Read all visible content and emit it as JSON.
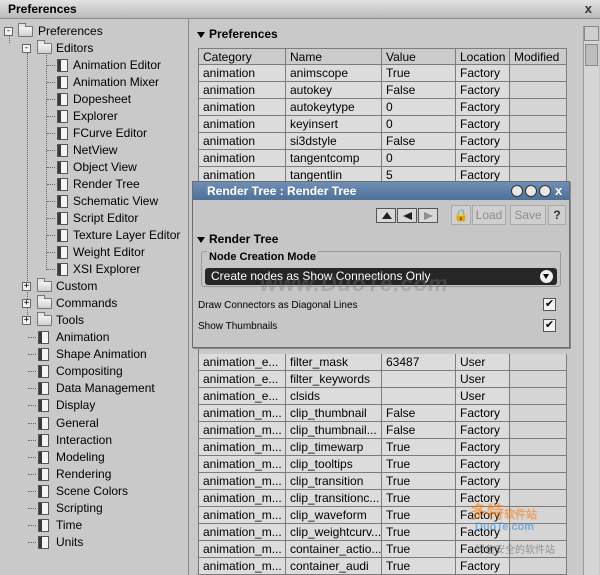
{
  "window": {
    "title": "Preferences",
    "close_glyph": "x"
  },
  "tree": {
    "root": "Preferences",
    "editors": {
      "label": "Editors",
      "items": [
        "Animation Editor",
        "Animation Mixer",
        "Dopesheet",
        "Explorer",
        "FCurve Editor",
        "NetView",
        "Object View",
        "Render Tree",
        "Schematic View",
        "Script Editor",
        "Texture Layer Editor",
        "Weight Editor",
        "XSI Explorer"
      ]
    },
    "folders": [
      "Custom",
      "Commands",
      "Tools"
    ],
    "pages": [
      "Animation",
      "Shape Animation",
      "Compositing",
      "Data Management",
      "Display",
      "General",
      "Interaction",
      "Modeling",
      "Rendering",
      "Scene Colors",
      "Scripting",
      "Time",
      "Units"
    ]
  },
  "prefs": {
    "section_title": "Preferences",
    "columns": [
      "Category",
      "Name",
      "Value",
      "Location",
      "Modified"
    ],
    "rows_top": [
      [
        "animation",
        "animscope",
        "True",
        "Factory",
        ""
      ],
      [
        "animation",
        "autokey",
        "False",
        "Factory",
        ""
      ],
      [
        "animation",
        "autokeytype",
        "0",
        "Factory",
        ""
      ],
      [
        "animation",
        "keyinsert",
        "0",
        "Factory",
        ""
      ],
      [
        "animation",
        "si3dstyle",
        "False",
        "Factory",
        ""
      ],
      [
        "animation",
        "tangentcomp",
        "0",
        "Factory",
        ""
      ],
      [
        "animation",
        "tangentlin",
        "5",
        "Factory",
        ""
      ]
    ],
    "rows_bottom": [
      [
        "animation_e...",
        "filter_mask",
        "63487",
        "User",
        ""
      ],
      [
        "animation_e...",
        "filter_keywords",
        "",
        "User",
        ""
      ],
      [
        "animation_e...",
        "clsids",
        "",
        "User",
        ""
      ],
      [
        "animation_m...",
        "clip_thumbnail",
        "False",
        "Factory",
        ""
      ],
      [
        "animation_m...",
        "clip_thumbnail...",
        "False",
        "Factory",
        ""
      ],
      [
        "animation_m...",
        "clip_timewarp",
        "True",
        "Factory",
        ""
      ],
      [
        "animation_m...",
        "clip_tooltips",
        "True",
        "Factory",
        ""
      ],
      [
        "animation_m...",
        "clip_transition",
        "True",
        "Factory",
        ""
      ],
      [
        "animation_m...",
        "clip_transitionc...",
        "True",
        "Factory",
        ""
      ],
      [
        "animation_m...",
        "clip_waveform",
        "True",
        "Factory",
        ""
      ],
      [
        "animation_m...",
        "clip_weightcurv...",
        "True",
        "Factory",
        ""
      ],
      [
        "animation_m...",
        "container_actio...",
        "True",
        "Factory",
        ""
      ],
      [
        "animation_m...",
        "container_audi",
        "True",
        "Factory",
        ""
      ]
    ]
  },
  "render_tree": {
    "title": "Render Tree : Render Tree",
    "load_label": "Load",
    "save_label": "Save",
    "help_label": "?",
    "section_title": "Render Tree",
    "node_creation_mode_label": "Node Creation Mode",
    "node_creation_mode_value": "Create nodes as Show Connections Only",
    "draw_connectors_label": "Draw Connectors as Diagonal Lines",
    "draw_connectors_checked": true,
    "show_thumbnails_label": "Show Thumbnails",
    "show_thumbnails_checked": true,
    "check_glyph": "✔"
  },
  "watermark": {
    "main": "www.DuoTe.com",
    "brand": "多特",
    "brand_sub": "软件站",
    "site": "DuoTe.com",
    "slogan": "绿色安全的软件站"
  },
  "colors": {
    "title_blue": "#5a7ba4",
    "select_bg": "#262626"
  }
}
